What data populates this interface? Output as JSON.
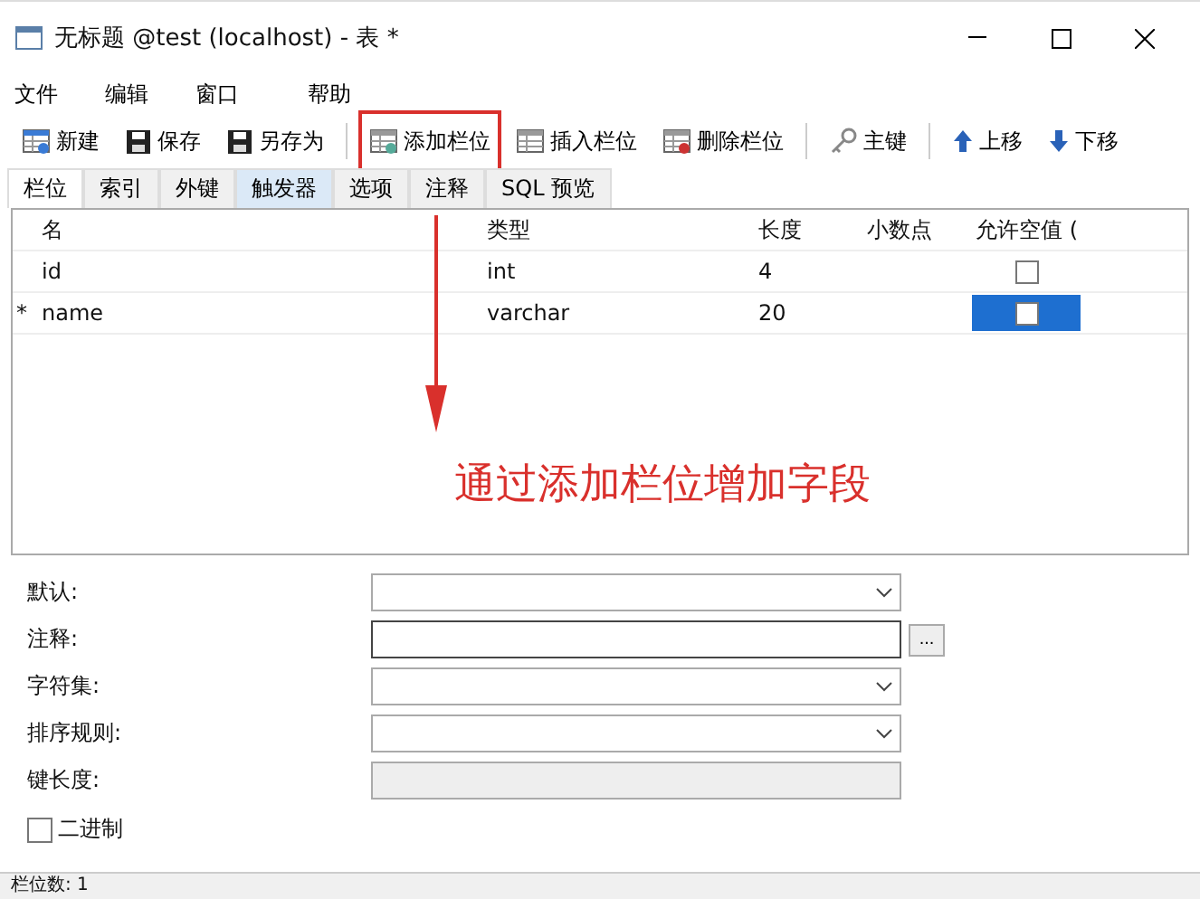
{
  "window": {
    "title": "无标题 @test (localhost) - 表 *"
  },
  "menu": [
    "文件",
    "编辑",
    "窗口",
    "帮助"
  ],
  "toolbar": [
    {
      "label": "新建",
      "annotated": false
    },
    {
      "label": "保存",
      "annotated": false
    },
    {
      "label": "另存为",
      "annotated": false
    },
    {
      "label": "添加栏位",
      "annotated": true
    },
    {
      "label": "插入栏位",
      "annotated": false
    },
    {
      "label": "删除栏位",
      "annotated": false
    },
    {
      "label": "主键",
      "annotated": false
    },
    {
      "label": "上移",
      "annotated": false
    },
    {
      "label": "下移",
      "annotated": false
    }
  ],
  "tabs": [
    {
      "label": "栏位",
      "selected": true,
      "highlighted": false
    },
    {
      "label": "索引",
      "selected": false,
      "highlighted": false
    },
    {
      "label": "外键",
      "selected": false,
      "highlighted": false
    },
    {
      "label": "触发器",
      "selected": false,
      "highlighted": true
    },
    {
      "label": "选项",
      "selected": false,
      "highlighted": false
    },
    {
      "label": "注释",
      "selected": false,
      "highlighted": false
    },
    {
      "label": "SQL 预览",
      "selected": false,
      "highlighted": false
    }
  ],
  "table": {
    "columns": [
      "名",
      "类型",
      "长度",
      "小数点",
      "允许空值 ("
    ],
    "rows": [
      {
        "marker": "",
        "name": "id",
        "type": "int",
        "length": "4",
        "decimals": "",
        "allow_null": false,
        "selected": false
      },
      {
        "marker": "*",
        "name": "name",
        "type": "varchar",
        "length": "20",
        "decimals": "",
        "allow_null": false,
        "selected": true
      }
    ]
  },
  "annotation": {
    "text": "通过添加栏位增加字段"
  },
  "properties": [
    {
      "label": "默认:",
      "kind": "dropdown"
    },
    {
      "label": "注释:",
      "kind": "text",
      "button": "..."
    },
    {
      "label": "字符集:",
      "kind": "dropdown"
    },
    {
      "label": "排序规则:",
      "kind": "dropdown"
    },
    {
      "label": "键长度:",
      "kind": "readonly"
    }
  ],
  "binary": {
    "label": "二进制",
    "checked": false
  },
  "status_bar": {
    "text": "栏位数: 1"
  }
}
